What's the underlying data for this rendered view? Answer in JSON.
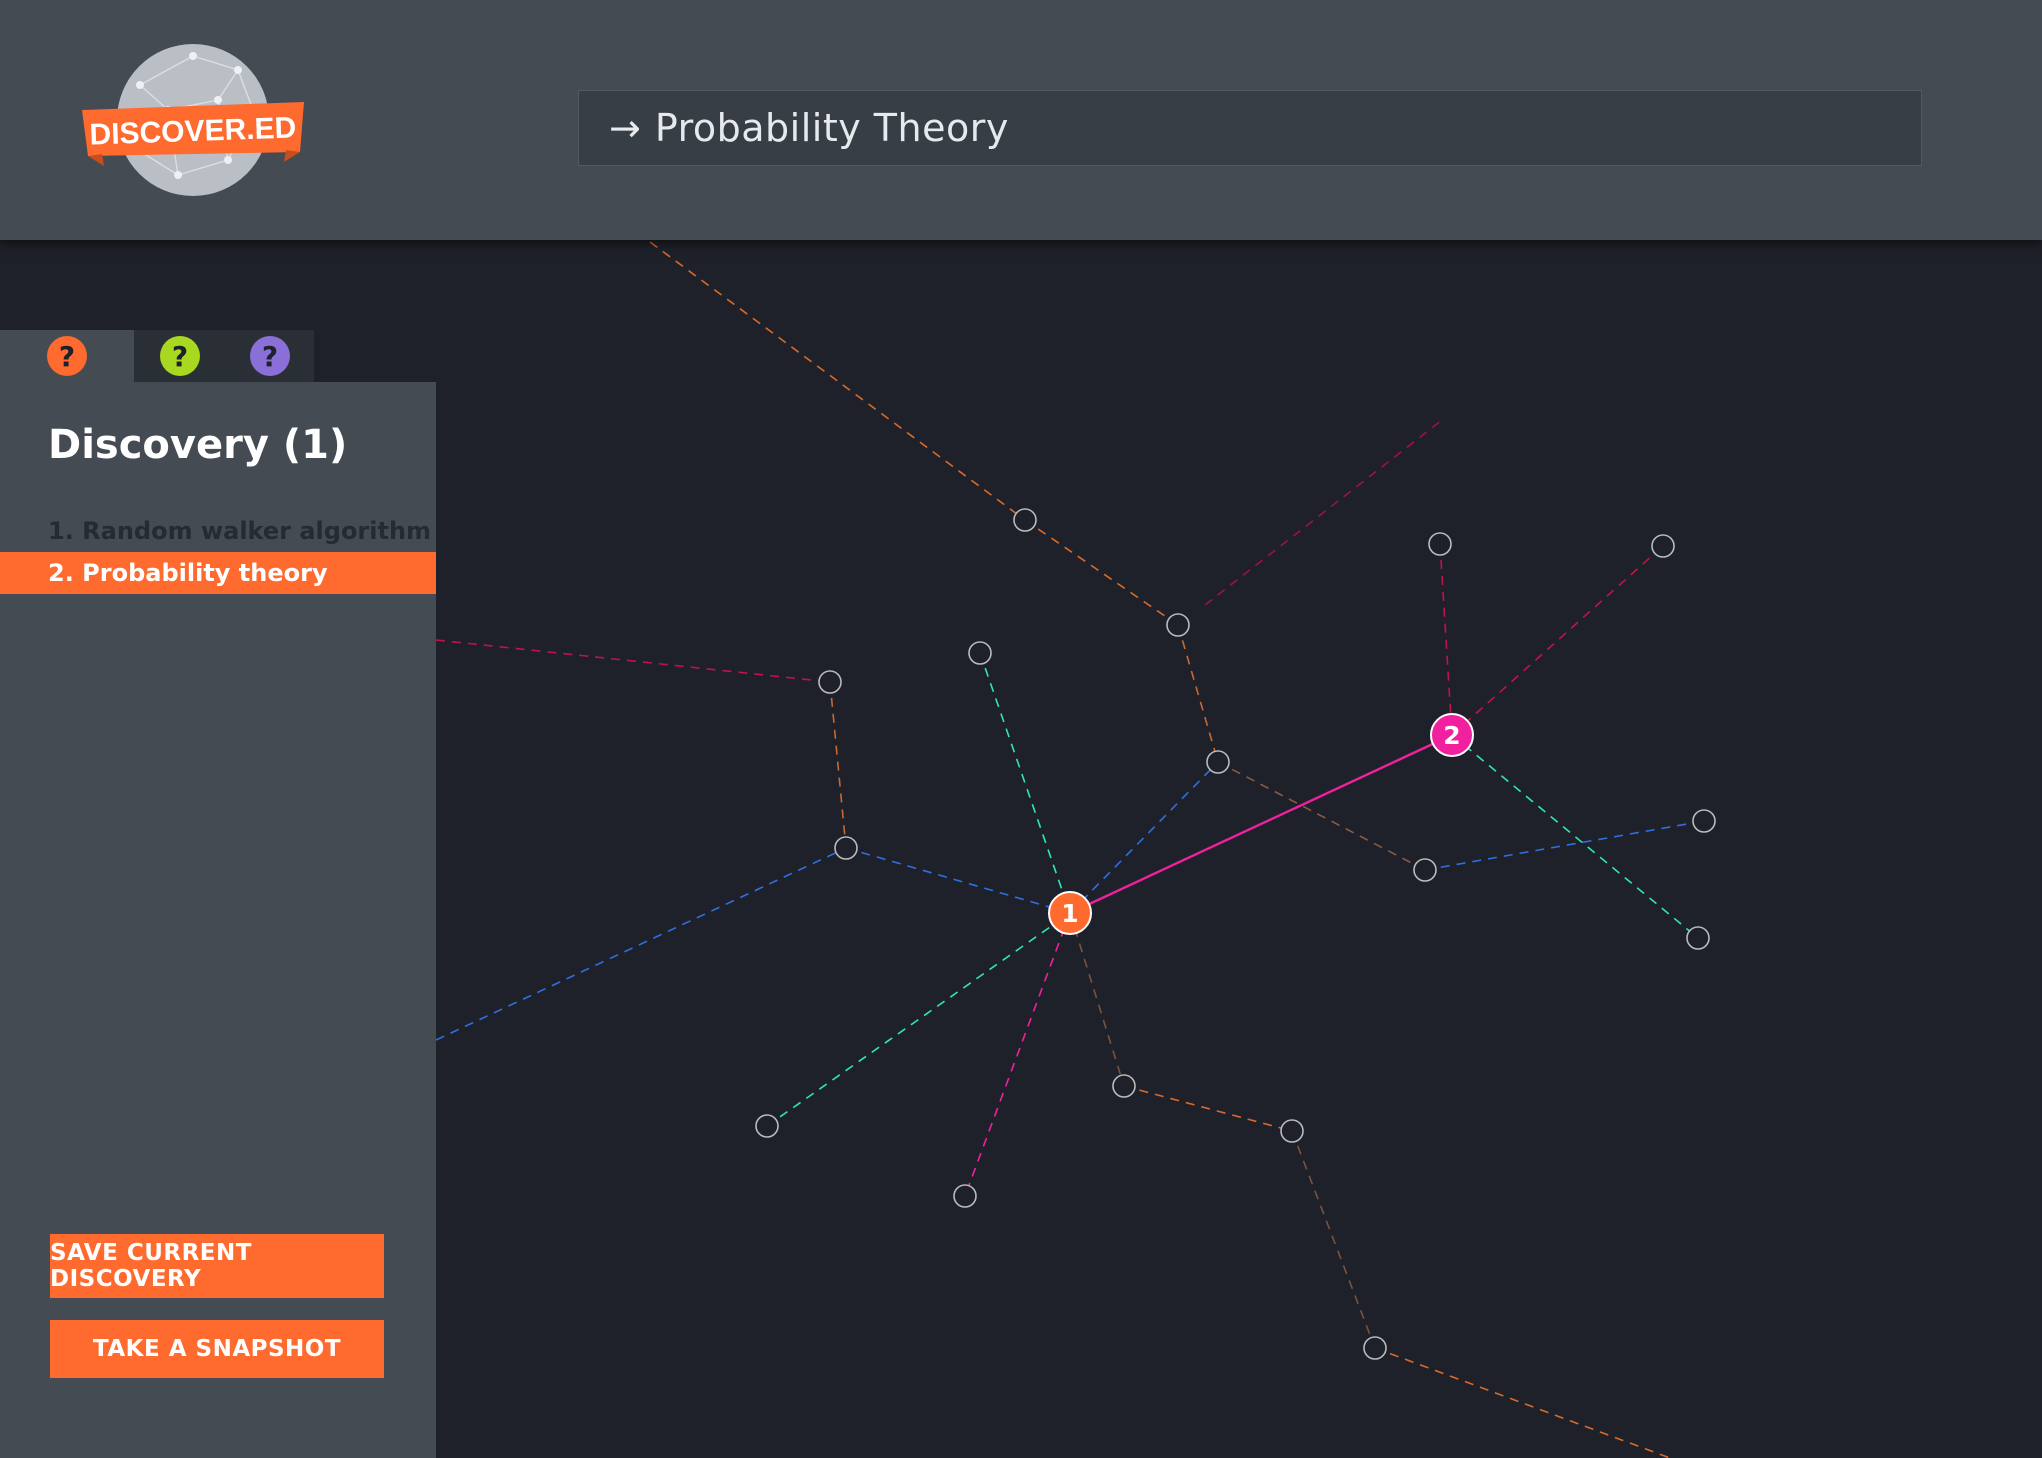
{
  "brand": {
    "logo_text": "DISCOVER.ED"
  },
  "search": {
    "arrow": "→",
    "query": "Probability Theory"
  },
  "tabs": [
    {
      "label": "?",
      "color": "#ff6a2f"
    },
    {
      "label": "?",
      "color": "#a8d820"
    },
    {
      "label": "?",
      "color": "#8a6fd8"
    }
  ],
  "sidebar": {
    "title": "Discovery (1)",
    "items": [
      {
        "label": "1. Random walker algorithm",
        "active": false
      },
      {
        "label": "2. Probability theory",
        "active": true
      }
    ],
    "save_label": "SAVE CURRENT DISCOVERY",
    "snapshot_label": "TAKE A SNAPSHOT"
  },
  "graph": {
    "main_nodes": [
      {
        "label": "1",
        "color": "#ff6a2f"
      },
      {
        "label": "2",
        "color": "#f0209e"
      }
    ]
  },
  "colors": {
    "accent": "#ff6a2f",
    "pink": "#f0209e",
    "teal": "#2ee6b8",
    "blue": "#2f6fe0",
    "crimson": "#c0134a",
    "orange_dash": "#d96a2a",
    "brown_dash": "#7a5240"
  }
}
